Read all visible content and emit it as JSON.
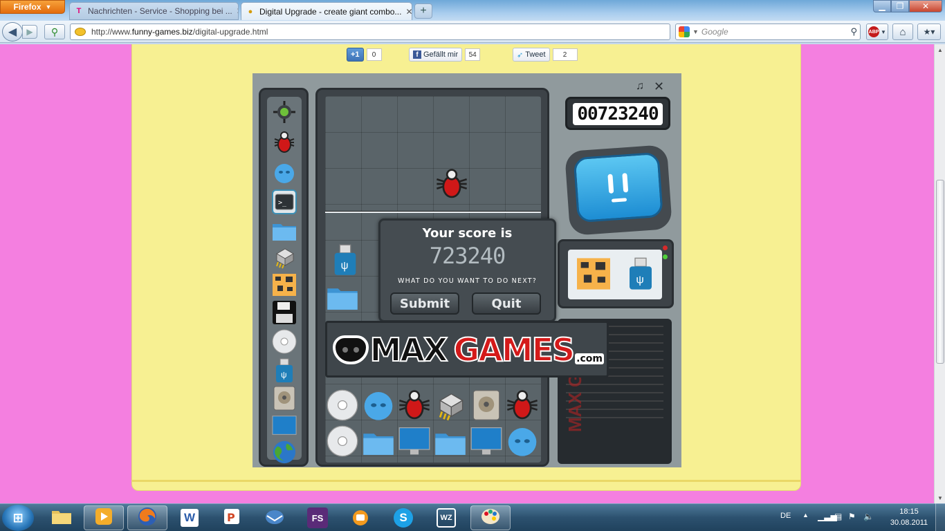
{
  "browser": {
    "menu_button": "Firefox",
    "tabs": [
      {
        "title": "Nachrichten - Service - Shopping bei ...",
        "favicon": "T",
        "active": false
      },
      {
        "title": "Digital Upgrade - create giant combo...",
        "favicon": "●",
        "active": true
      }
    ],
    "url_prefix": "http://www.",
    "url_domain": "funny-games.biz",
    "url_path": "/digital-upgrade.html",
    "search_placeholder": "Google"
  },
  "social": {
    "plusone_label": "+1",
    "plusone_count": "0",
    "like_label": "Gefällt mir",
    "like_count": "54",
    "tweet_label": "Tweet",
    "tweet_count": "2"
  },
  "game": {
    "score": "00723240",
    "popup": {
      "title": "Your score is",
      "score": "723240",
      "question": "WHAT DO YOU WANT TO DO NEXT?",
      "submit_label": "Submit",
      "quit_label": "Quit"
    },
    "banner": {
      "part1": "MAX",
      "part2": "GAMES",
      "suffix": ".com"
    },
    "side_logo": "MAX GA"
  },
  "taskbar": {
    "apps": [
      "explorer",
      "media-player",
      "firefox",
      "word",
      "powerpoint",
      "thunderbird",
      "fs",
      "vlc",
      "skype",
      "wz",
      "paint"
    ],
    "fs_label": "FS",
    "wz_label": "WZ",
    "word_label": "W",
    "lang": "DE",
    "time": "18:15",
    "date": "30.08.2011"
  },
  "colors": {
    "page_bg": "#f47fe0",
    "content_bg": "#f7f092",
    "game_bg": "#909a9d",
    "brand_red": "#d41a1a"
  }
}
